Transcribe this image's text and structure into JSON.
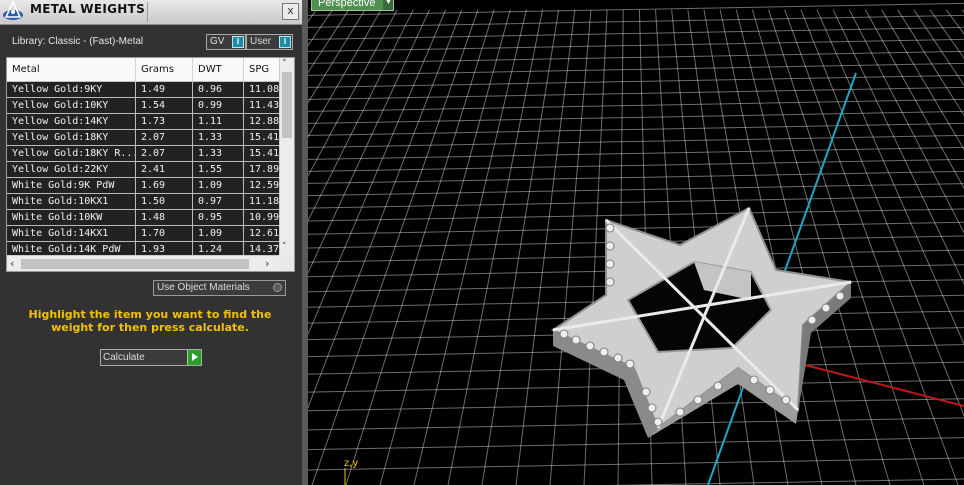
{
  "panel": {
    "title": "METAL WEIGHTS",
    "close_label": "x",
    "library_label": "Library: Classic - (Fast)-Metal",
    "dropdown_gv": "GV",
    "dropdown_user": "User"
  },
  "table": {
    "columns": [
      "Metal",
      "Grams",
      "DWT",
      "SPG"
    ],
    "rows": [
      [
        "Yellow Gold:9KY",
        "1.49",
        "0.96",
        "11.08"
      ],
      [
        "Yellow Gold:10KY",
        "1.54",
        "0.99",
        "11.43"
      ],
      [
        "Yellow Gold:14KY",
        "1.73",
        "1.11",
        "12.88"
      ],
      [
        "Yellow Gold:18KY",
        "2.07",
        "1.33",
        "15.41"
      ],
      [
        "Yellow Gold:18KY R...",
        "2.07",
        "1.33",
        "15.41"
      ],
      [
        "Yellow Gold:22KY",
        "2.41",
        "1.55",
        "17.89"
      ],
      [
        "White Gold:9K PdW",
        "1.69",
        "1.09",
        "12.59"
      ],
      [
        "White Gold:10KX1",
        "1.50",
        "0.97",
        "11.18"
      ],
      [
        "White Gold:10KW",
        "1.48",
        "0.95",
        "10.99"
      ],
      [
        "White Gold:14KX1",
        "1.70",
        "1.09",
        "12.61"
      ],
      [
        "White Gold:14K PdW",
        "1.93",
        "1.24",
        "14.37"
      ]
    ]
  },
  "options": {
    "use_object_materials": "Use Object Materials"
  },
  "instruction": "Highlight the item you want to find the weight for then press calculate.",
  "calculate_label": "Calculate",
  "viewport": {
    "view_name": "Perspective",
    "axis_label": "z,y"
  },
  "colors": {
    "instruction_text": "#f2c200",
    "x_axis": "#c01818",
    "y_axis": "#1ea7c8",
    "grid": "#ffffff",
    "calculate_play": "#2aa02a",
    "view_label_bg": "#4f8f4f"
  }
}
